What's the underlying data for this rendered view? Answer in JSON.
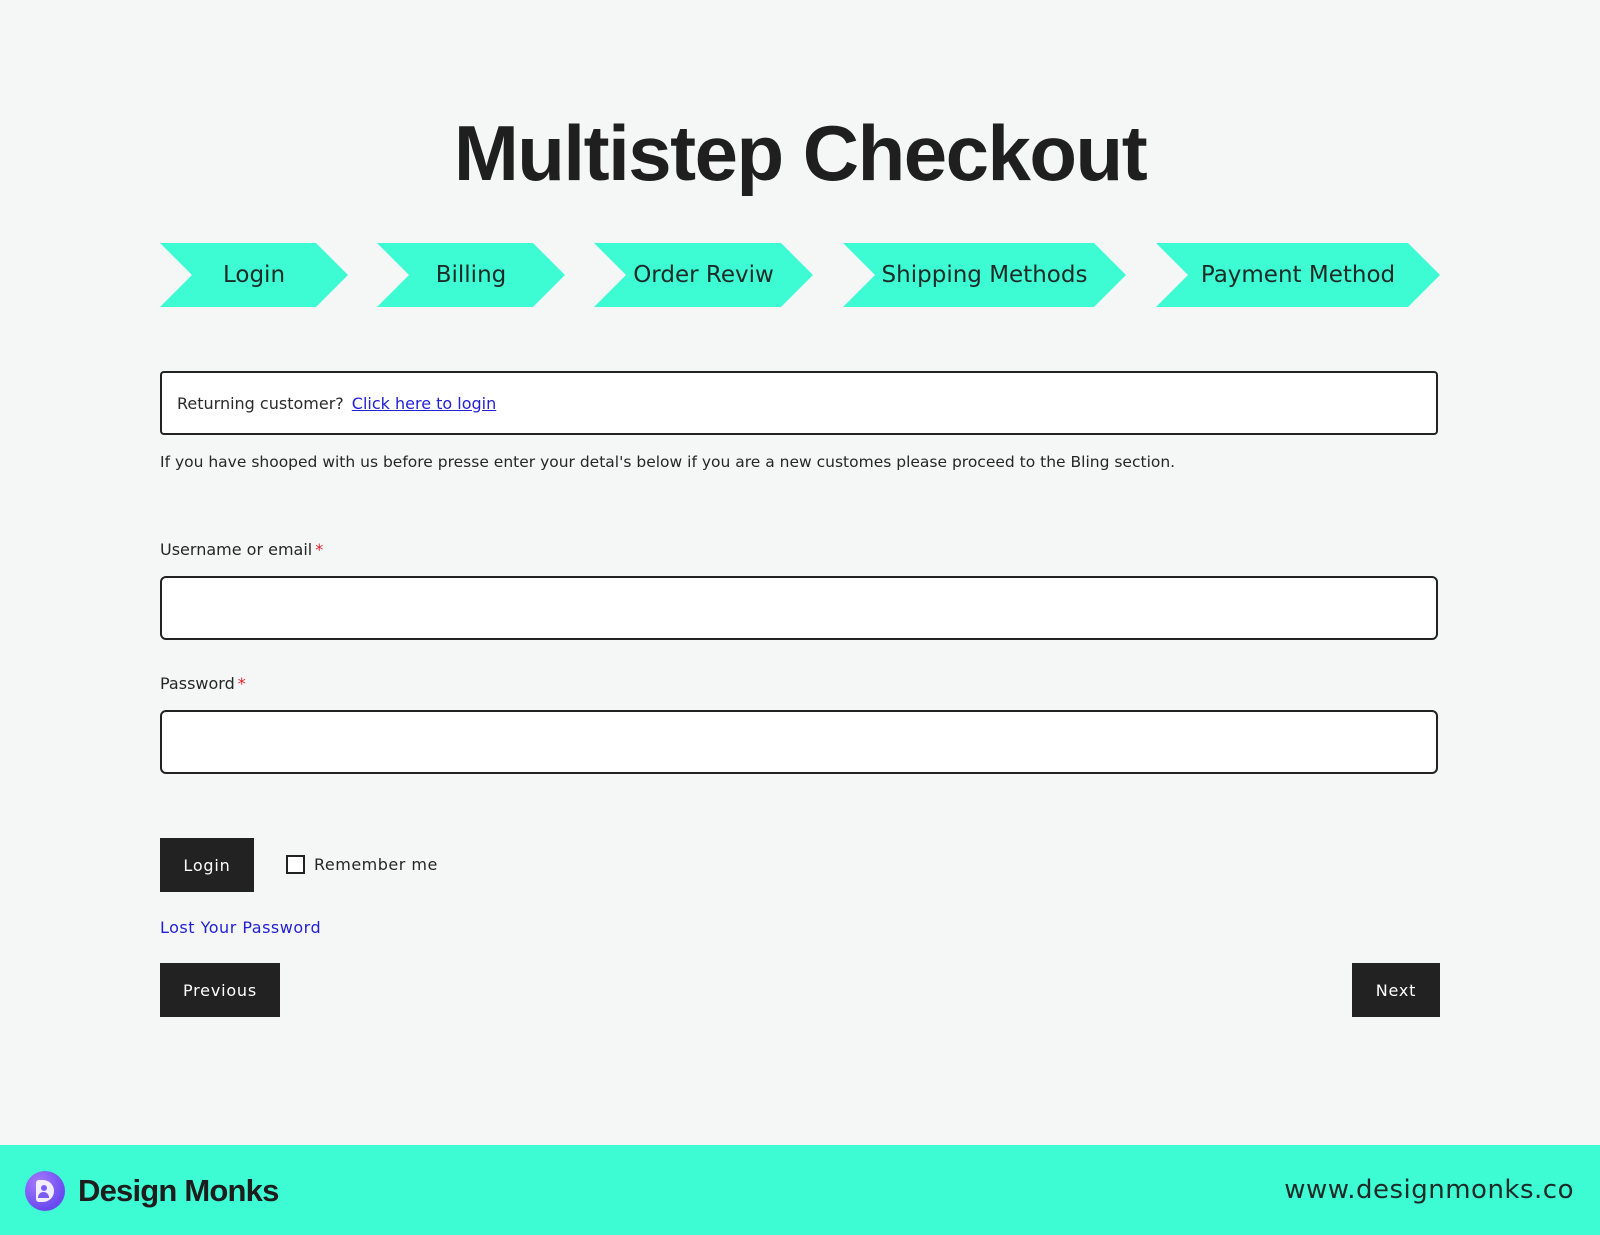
{
  "page": {
    "title": "Multistep Checkout"
  },
  "steps": [
    {
      "label": "Login"
    },
    {
      "label": "Billing"
    },
    {
      "label": "Order Reviw"
    },
    {
      "label": "Shipping Methods"
    },
    {
      "label": "Payment Method"
    }
  ],
  "notice": {
    "text": "Returning customer?",
    "link": "Click here to login"
  },
  "intro": "If you have shooped with us before presse enter your detal's below if you are a new customes please proceed to the Bling section.",
  "form": {
    "username_label": "Username or email",
    "username_value": "",
    "password_label": "Password",
    "password_value": "",
    "required_mark": "*",
    "login_button": "Login",
    "remember_label": "Remember me",
    "remember_checked": false,
    "lost_password": "Lost Your Password"
  },
  "nav": {
    "previous": "Previous",
    "next": "Next"
  },
  "footer": {
    "brand": "Design Monks",
    "website": "www.designmonks.co",
    "logo_icon": "design-monks-logo"
  },
  "colors": {
    "accent": "#3dfbd2",
    "background": "#f5f7f6",
    "dark": "#222222",
    "link": "#2320d6",
    "required": "#e0202a",
    "logo": "#6a4af0"
  }
}
